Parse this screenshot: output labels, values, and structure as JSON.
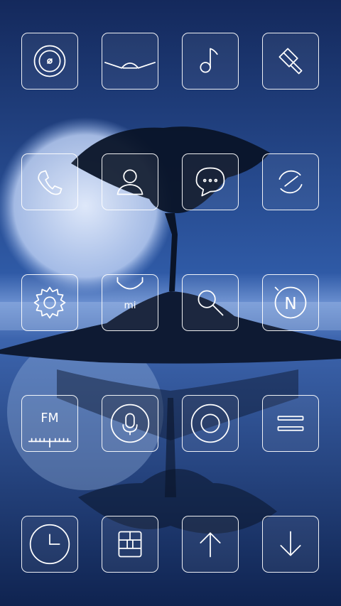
{
  "screen": {
    "wallpaper": "night-lake-moon-tree",
    "accent": "#ffffff",
    "sky_top": "#1d3a78",
    "sky_mid": "#3a64b0",
    "water": "#2b4f93"
  },
  "rows": [
    {
      "icons": [
        {
          "name": "camera-icon"
        },
        {
          "name": "gallery-icon"
        },
        {
          "name": "music-icon"
        },
        {
          "name": "themes-brush-icon"
        }
      ]
    },
    {
      "icons": [
        {
          "name": "phone-icon"
        },
        {
          "name": "contacts-icon"
        },
        {
          "name": "messages-icon"
        },
        {
          "name": "browser-icon"
        }
      ]
    },
    {
      "icons": [
        {
          "name": "settings-gear-icon"
        },
        {
          "name": "mi-store-icon",
          "label": "mi"
        },
        {
          "name": "search-icon"
        },
        {
          "name": "compass-icon",
          "label": "N"
        }
      ]
    },
    {
      "icons": [
        {
          "name": "fm-radio-icon",
          "label": "FM"
        },
        {
          "name": "voice-recorder-icon"
        },
        {
          "name": "screen-recorder-icon"
        },
        {
          "name": "notes-icon"
        }
      ]
    },
    {
      "icons": [
        {
          "name": "clock-icon"
        },
        {
          "name": "sim-toolkit-icon"
        },
        {
          "name": "upload-arrow-icon"
        },
        {
          "name": "download-arrow-icon"
        }
      ]
    }
  ]
}
